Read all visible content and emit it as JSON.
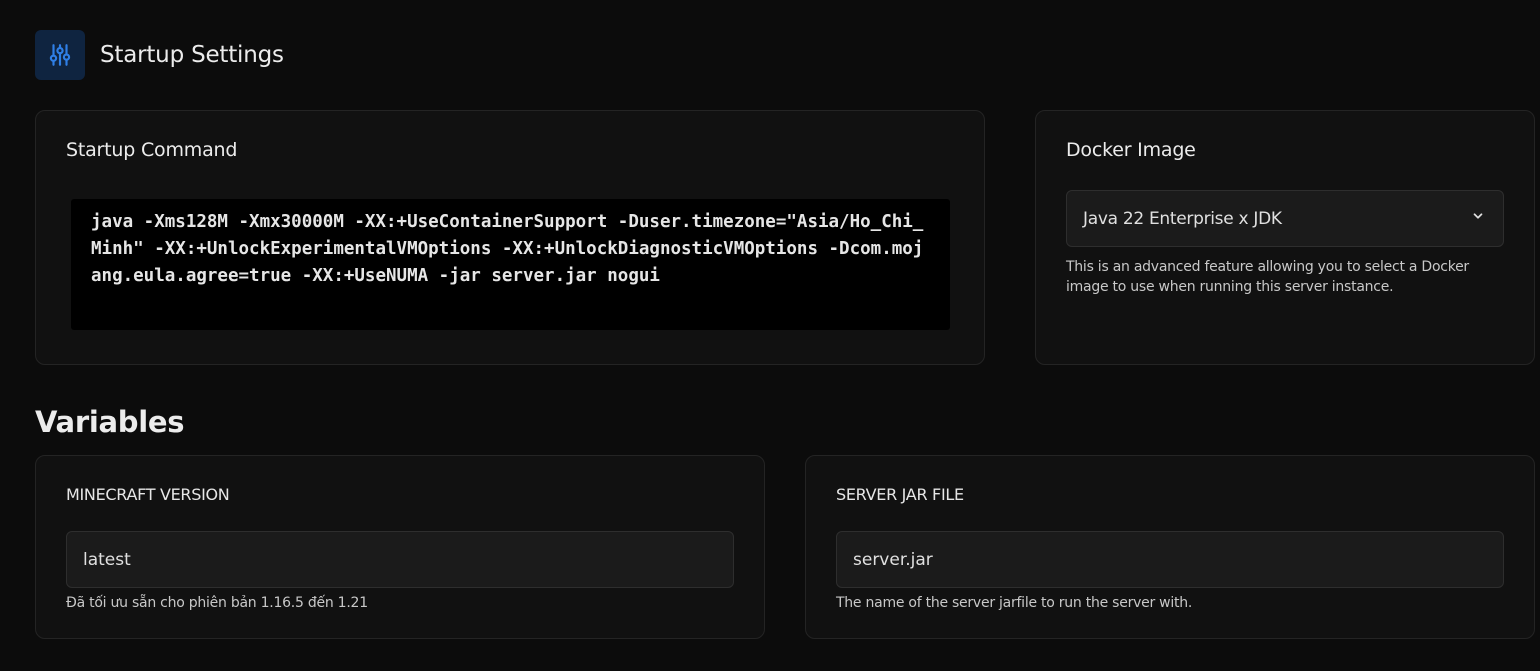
{
  "header": {
    "title": "Startup Settings",
    "icon": "sliders-icon",
    "icon_color": "#2f7fe6"
  },
  "startup": {
    "title": "Startup Command",
    "command": "java -Xms128M -Xmx30000M -XX:+UseContainerSupport -Duser.timezone=\"Asia/Ho_Chi_Minh\" -XX:+UnlockExperimentalVMOptions -XX:+UnlockDiagnosticVMOptions -Dcom.mojang.eula.agree=true -XX:+UseNUMA -jar server.jar nogui"
  },
  "docker": {
    "title": "Docker Image",
    "selected": "Java 22 Enterprise x JDK",
    "help": "This is an advanced feature allowing you to select a Docker image to use when running this server instance."
  },
  "variables": {
    "title": "Variables",
    "items": [
      {
        "label": "MINECRAFT VERSION",
        "value": "latest",
        "help": "Đã tối ưu sẵn cho phiên bản 1.16.5 đến 1.21"
      },
      {
        "label": "SERVER JAR FILE",
        "value": "server.jar",
        "help": "The name of the server jarfile to run the server with."
      }
    ]
  }
}
